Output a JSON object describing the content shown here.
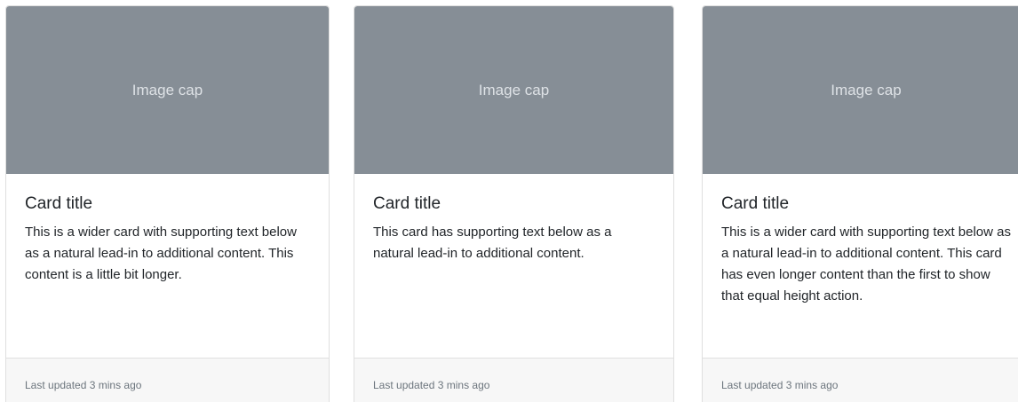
{
  "cards": [
    {
      "image_cap": "Image cap",
      "title": "Card title",
      "text": "This is a wider card with supporting text below as a natural lead-in to additional content. This content is a little bit longer.",
      "footer": "Last updated 3 mins ago"
    },
    {
      "image_cap": "Image cap",
      "title": "Card title",
      "text": "This card has supporting text below as a natural lead-in to additional content.",
      "footer": "Last updated 3 mins ago"
    },
    {
      "image_cap": "Image cap",
      "title": "Card title",
      "text": "This is a wider card with supporting text below as a natural lead-in to additional content. This card has even longer content than the first to show that equal height action.",
      "footer": "Last updated 3 mins ago"
    }
  ],
  "colors": {
    "image_placeholder": "#868e96",
    "footer_background": "#f7f7f7"
  }
}
